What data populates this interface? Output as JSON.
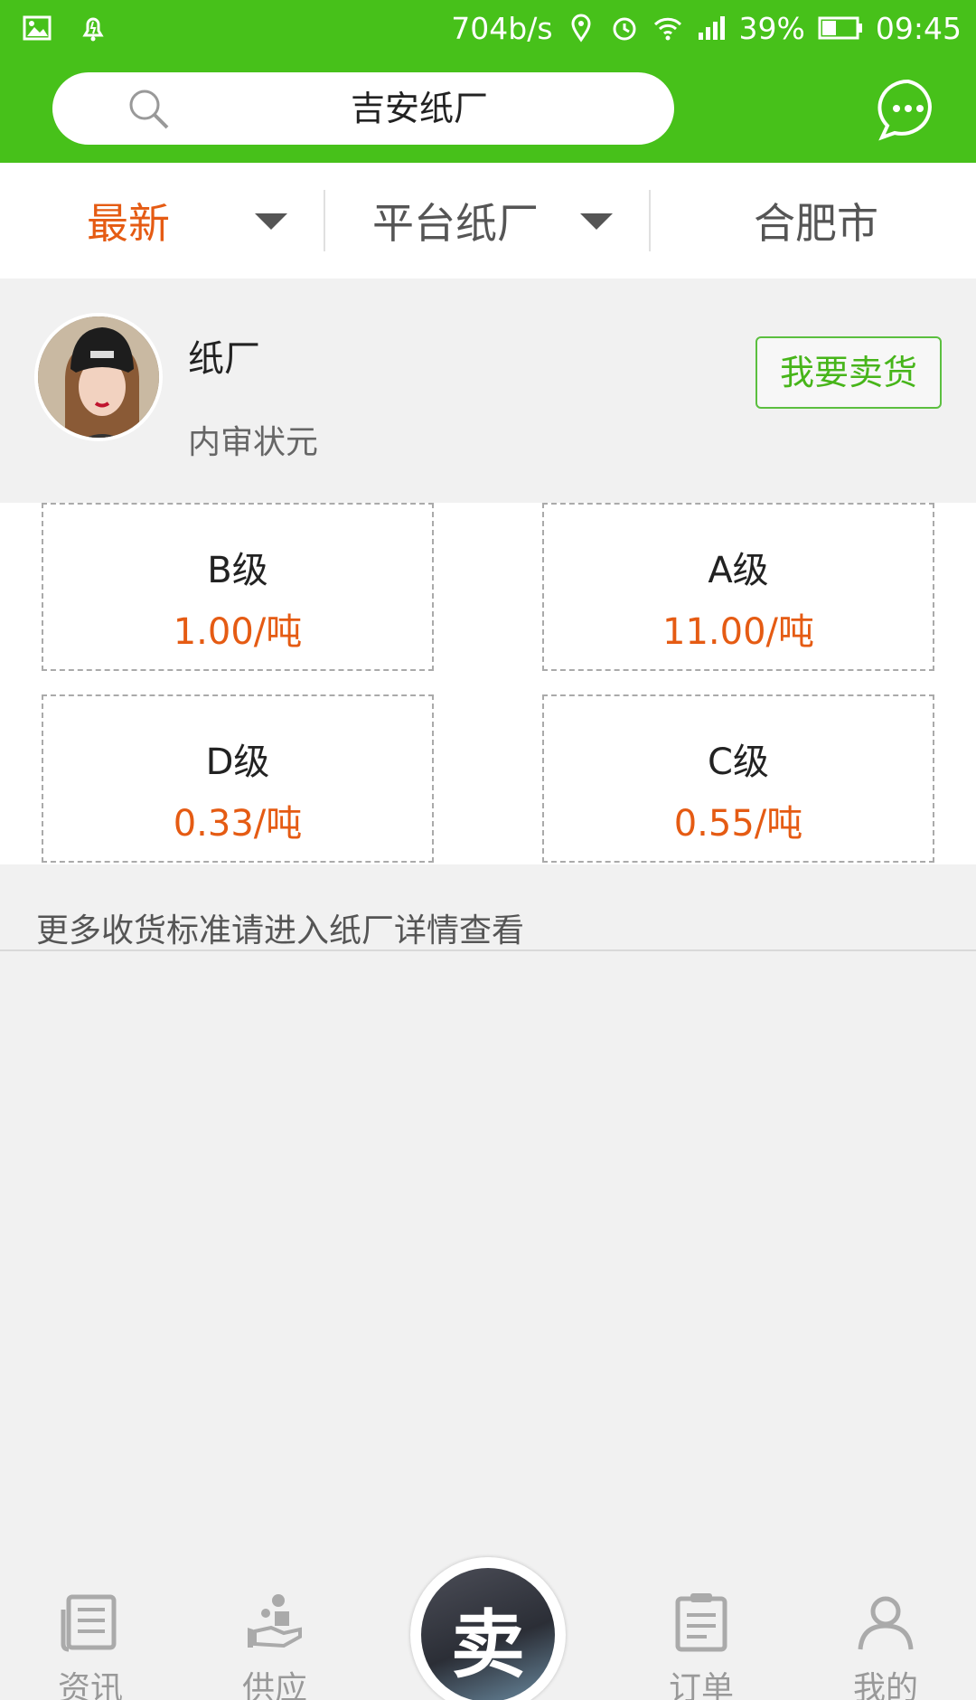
{
  "status_bar": {
    "net_speed": "704b/s",
    "battery": "39%",
    "time": "09:45"
  },
  "header": {
    "search_value": "吉安纸厂"
  },
  "filters": [
    {
      "label": "最新",
      "active": true
    },
    {
      "label": "平台纸厂",
      "active": false
    },
    {
      "label": "合肥市",
      "active": false
    }
  ],
  "factory": {
    "name": "纸厂",
    "subtitle": "内审状元",
    "sell_button": "我要卖货"
  },
  "grades": [
    {
      "name": "B级",
      "price": "1.00/吨"
    },
    {
      "name": "A级",
      "price": "11.00/吨"
    },
    {
      "name": "D级",
      "price": "0.33/吨"
    },
    {
      "name": "C级",
      "price": "0.55/吨"
    }
  ],
  "more_note": "更多收货标准请进入纸厂详情查看",
  "bottom_nav": {
    "items": [
      {
        "label": "资讯",
        "icon": "news-icon"
      },
      {
        "label": "供应",
        "icon": "supply-icon"
      },
      {
        "label": "订单",
        "icon": "order-icon"
      },
      {
        "label": "我的",
        "icon": "profile-icon"
      }
    ],
    "center_label": "卖"
  },
  "colors": {
    "brand_green": "#47c11a",
    "accent_orange": "#e55b13"
  }
}
